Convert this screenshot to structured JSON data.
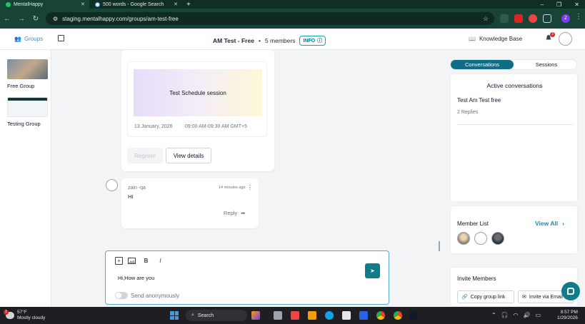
{
  "browser": {
    "tabs": [
      {
        "label": "MentalHappy",
        "active": true
      },
      {
        "label": "500 words - Google Search",
        "active": false
      }
    ],
    "url": "staging.mentalhappy.com/groups/am-test-free",
    "profile_initial": "Z"
  },
  "header": {
    "groups_label": "Groups",
    "group_name": "AM Test - Free",
    "members_count": "5 members",
    "info_label": "INFO",
    "knowledge_base": "Knowledge Base",
    "notification_count": "3"
  },
  "sidebar": {
    "items": [
      {
        "label": "Free Group"
      },
      {
        "label": "Testing Group"
      }
    ]
  },
  "event": {
    "title": "Test Schedule session",
    "date": "13 January, 2026",
    "time": "09:00 AM-09:30 AM GMT+5",
    "register_label": "Register",
    "view_details_label": "View details"
  },
  "comment": {
    "author": "zain -qa",
    "time": "14 minutes ago",
    "text": "HI",
    "reply_label": "Reply"
  },
  "composer": {
    "bold": "B",
    "italic": "I",
    "text": "Hi,How are you",
    "anon_label": "Send anonymously"
  },
  "right_panel": {
    "tabs": {
      "conversations": "Conversations",
      "sessions": "Sessions"
    },
    "active_title": "Active conversations",
    "conversations": [
      {
        "name": "Test Am Test free",
        "replies": "2 Replies"
      }
    ],
    "member_list_title": "Member List",
    "view_all": "View All",
    "invite_title": "Invite Members",
    "copy_link": "Copy group link",
    "invite_email": "Invite via Email"
  },
  "taskbar": {
    "temperature": "57°F",
    "weather": "Mostly cloudy",
    "search": "Search",
    "time": "8:57 PM",
    "date": "1/29/2026"
  },
  "colors": {
    "brand_teal": "#0f6e86",
    "link_blue": "#1a8bb0",
    "browser_green": "#174437"
  }
}
